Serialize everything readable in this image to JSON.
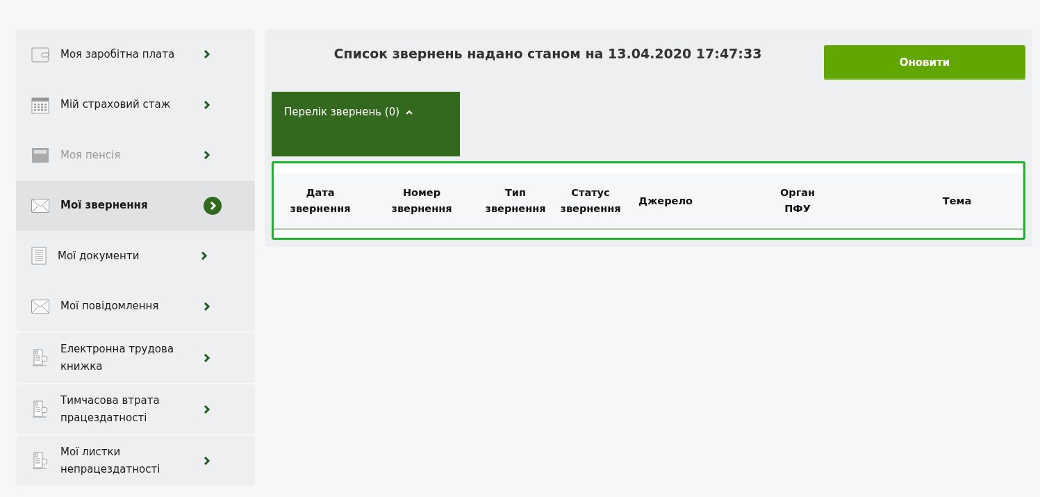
{
  "sidebar": {
    "groups": [
      {
        "items": [
          {
            "label": "Моя заробітна плата",
            "kind": "wallet",
            "selected": false,
            "disabled": false
          },
          {
            "label": "Мій страховий стаж",
            "kind": "calendar",
            "selected": false,
            "disabled": false
          },
          {
            "label": "Моя пенсія",
            "kind": "folder",
            "selected": false,
            "disabled": true
          },
          {
            "label": "Мої звернення",
            "kind": "envelope",
            "selected": true,
            "disabled": false
          },
          {
            "label": "Мої документи",
            "kind": "document",
            "selected": false,
            "disabled": false
          },
          {
            "label": "Мої повідомлення",
            "kind": "envelope",
            "selected": false,
            "disabled": false
          }
        ]
      },
      {
        "items": [
          {
            "label": "Електронна трудова книжка",
            "kind": "scroll",
            "selected": false,
            "disabled": false
          }
        ]
      },
      {
        "items": [
          {
            "label": "Тимчасова втрата працездатності",
            "kind": "scroll",
            "selected": false,
            "disabled": false
          }
        ]
      },
      {
        "items": [
          {
            "label": "Мої листки непрацездатності",
            "kind": "scroll",
            "selected": false,
            "disabled": false
          }
        ]
      }
    ]
  },
  "main": {
    "title": "Список звернень надано станом на 13.04.2020 17:47:33",
    "refresh_button": "Оновити",
    "accordion": {
      "label": "Перелік звернень (0)",
      "expanded": true
    },
    "table": {
      "columns": [
        "Дата звернення",
        "Номер звернення",
        "Тип звернення",
        "Статус звернення",
        "Джерело",
        "Орган ПФУ",
        "Тема"
      ]
    }
  }
}
